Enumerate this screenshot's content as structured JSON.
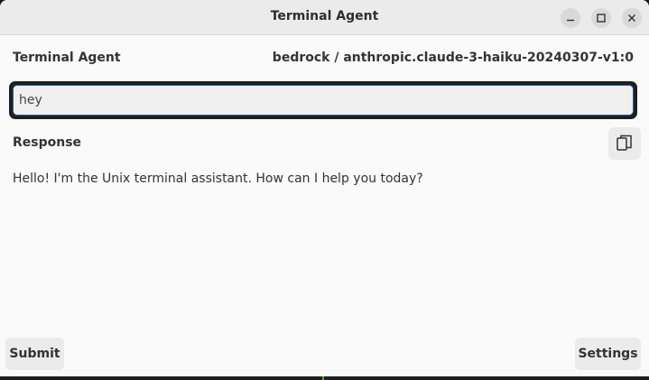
{
  "window": {
    "title": "Terminal Agent"
  },
  "header": {
    "title": "Terminal Agent",
    "model": "bedrock / anthropic.claude-3-haiku-20240307-v1:0"
  },
  "query": {
    "value": "hey",
    "placeholder": ""
  },
  "response": {
    "label": "Response",
    "text": "Hello! I'm the Unix terminal assistant. How can I help you today?"
  },
  "footer": {
    "submit_label": "Submit",
    "settings_label": "Settings"
  },
  "icons": {
    "minimize": "minimize-icon",
    "maximize": "maximize-icon",
    "close": "close-icon",
    "copy": "copy-icon"
  }
}
